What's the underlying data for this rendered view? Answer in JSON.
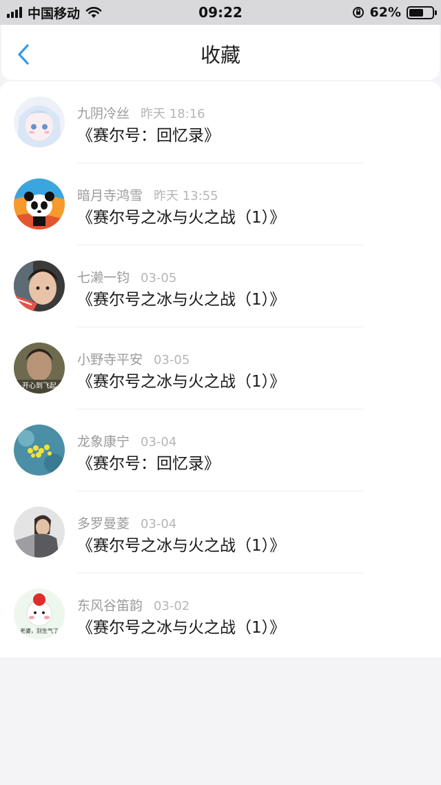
{
  "status_bar": {
    "carrier": "中国移动",
    "time": "09:22",
    "battery_percent": "62%",
    "battery_level": 0.62
  },
  "nav": {
    "title": "收藏",
    "back_icon": "chevron-left-icon"
  },
  "favorites": [
    {
      "author": "九阴冷丝",
      "time": "昨天 18:16",
      "title": "《赛尔号：回忆录》"
    },
    {
      "author": "暗月寺鸿雪",
      "time": "昨天 13:55",
      "title": "《赛尔号之冰与火之战（1）》"
    },
    {
      "author": "七濑一钧",
      "time": "03-05",
      "title": "《赛尔号之冰与火之战（1）》"
    },
    {
      "author": "小野寺平安",
      "time": "03-05",
      "title": "《赛尔号之冰与火之战（1）》"
    },
    {
      "author": "龙象康宁",
      "time": "03-04",
      "title": "《赛尔号：回忆录》"
    },
    {
      "author": "多罗曼菱",
      "time": "03-04",
      "title": "《赛尔号之冰与火之战（1）》"
    },
    {
      "author": "东风谷笛韵",
      "time": "03-02",
      "title": "《赛尔号之冰与火之战（1）》"
    }
  ],
  "avatar_text": {
    "avatar_4": "开心到飞起",
    "avatar_7": "老婆，别生气了"
  },
  "colors": {
    "accent": "#2f9bea",
    "status_bar_bg": "#d9d9dc"
  }
}
